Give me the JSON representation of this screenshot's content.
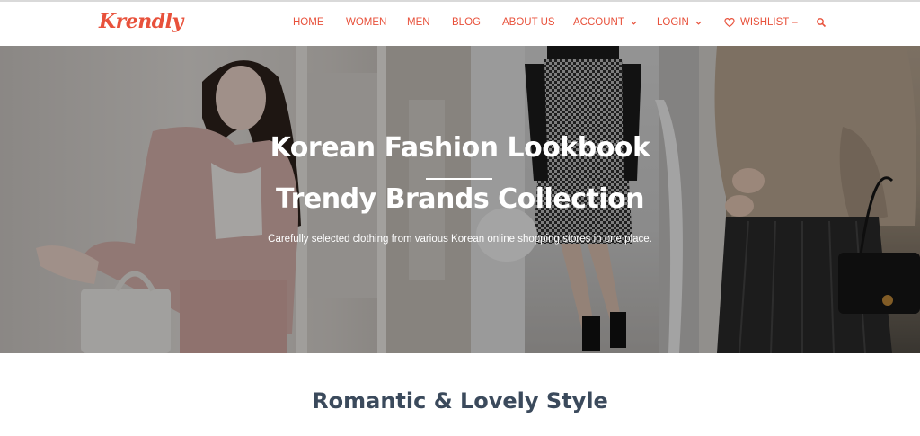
{
  "header": {
    "logo": "Krendly",
    "nav": {
      "home": "HOME",
      "women": "WOMEN",
      "men": "MEN",
      "blog": "BLOG",
      "about": "ABOUT US",
      "account": "ACCOUNT",
      "login": "LOGIN",
      "wishlist": "WISHLIST –"
    },
    "icons": {
      "account_chevron": "chevron-down-icon",
      "login_chevron": "chevron-down-icon",
      "wishlist": "heart-icon",
      "search": "search-icon"
    }
  },
  "hero": {
    "title_line1": "Korean Fashion Lookbook",
    "title_line2": "Trendy Brands Collection",
    "subtitle": "Carefully selected clothing from various Korean online shopping stores in one place."
  },
  "section": {
    "title": "Romantic & Lovely Style"
  },
  "colors": {
    "accent": "#e8513b",
    "heading": "#3b4a5c"
  }
}
